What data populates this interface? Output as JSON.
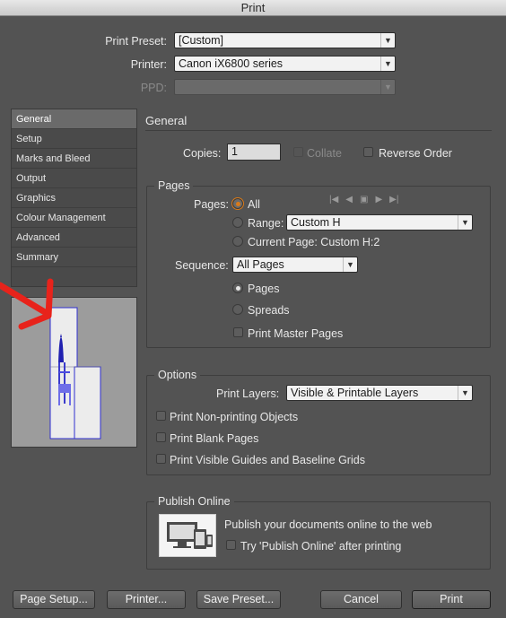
{
  "window": {
    "title": "Print"
  },
  "header": {
    "print_preset_label": "Print Preset:",
    "print_preset_value": "[Custom]",
    "printer_label": "Printer:",
    "printer_value": "Canon iX6800 series",
    "ppd_label": "PPD:",
    "ppd_value": ""
  },
  "sidebar": {
    "items": [
      {
        "label": "General"
      },
      {
        "label": "Setup"
      },
      {
        "label": "Marks and Bleed"
      },
      {
        "label": "Output"
      },
      {
        "label": "Graphics"
      },
      {
        "label": "Colour Management"
      },
      {
        "label": "Advanced"
      },
      {
        "label": "Summary"
      }
    ],
    "active": "General"
  },
  "general": {
    "heading": "General",
    "copies_label": "Copies:",
    "copies_value": "1",
    "collate_label": "Collate",
    "collate_checked": false,
    "collate_enabled": false,
    "reverse_label": "Reverse Order",
    "reverse_checked": false
  },
  "pages": {
    "heading": "Pages",
    "pages_label": "Pages:",
    "all_label": "All",
    "all_selected": true,
    "range_label": "Range:",
    "range_value": "Custom H",
    "current_label": "Current Page: Custom H:2",
    "sequence_label": "Sequence:",
    "sequence_value": "All Pages",
    "pages_radio_label": "Pages",
    "pages_radio_selected": true,
    "spreads_label": "Spreads",
    "master_label": "Print Master Pages",
    "master_checked": false
  },
  "options": {
    "heading": "Options",
    "layers_label": "Print Layers:",
    "layers_value": "Visible & Printable Layers",
    "nonprinting_label": "Print Non-printing Objects",
    "blank_label": "Print Blank Pages",
    "guides_label": "Print Visible Guides and Baseline Grids"
  },
  "publish": {
    "heading": "Publish Online",
    "text": "Publish your documents online to the web",
    "try_label": "Try 'Publish Online' after printing"
  },
  "footer": {
    "page_setup": "Page Setup...",
    "printer": "Printer...",
    "save_preset": "Save Preset...",
    "cancel": "Cancel",
    "print": "Print"
  },
  "colors": {
    "dialog_bg": "#535353",
    "annotation_arrow": "#e8231b",
    "preview_stroke": "#2f2fd0",
    "radio_accent": "#d97a1a"
  },
  "icons": [
    "first-page-icon",
    "prev-page-icon",
    "page-spread-icon",
    "next-page-icon",
    "last-page-icon",
    "publish-devices-icon",
    "red-annotation-arrow"
  ]
}
